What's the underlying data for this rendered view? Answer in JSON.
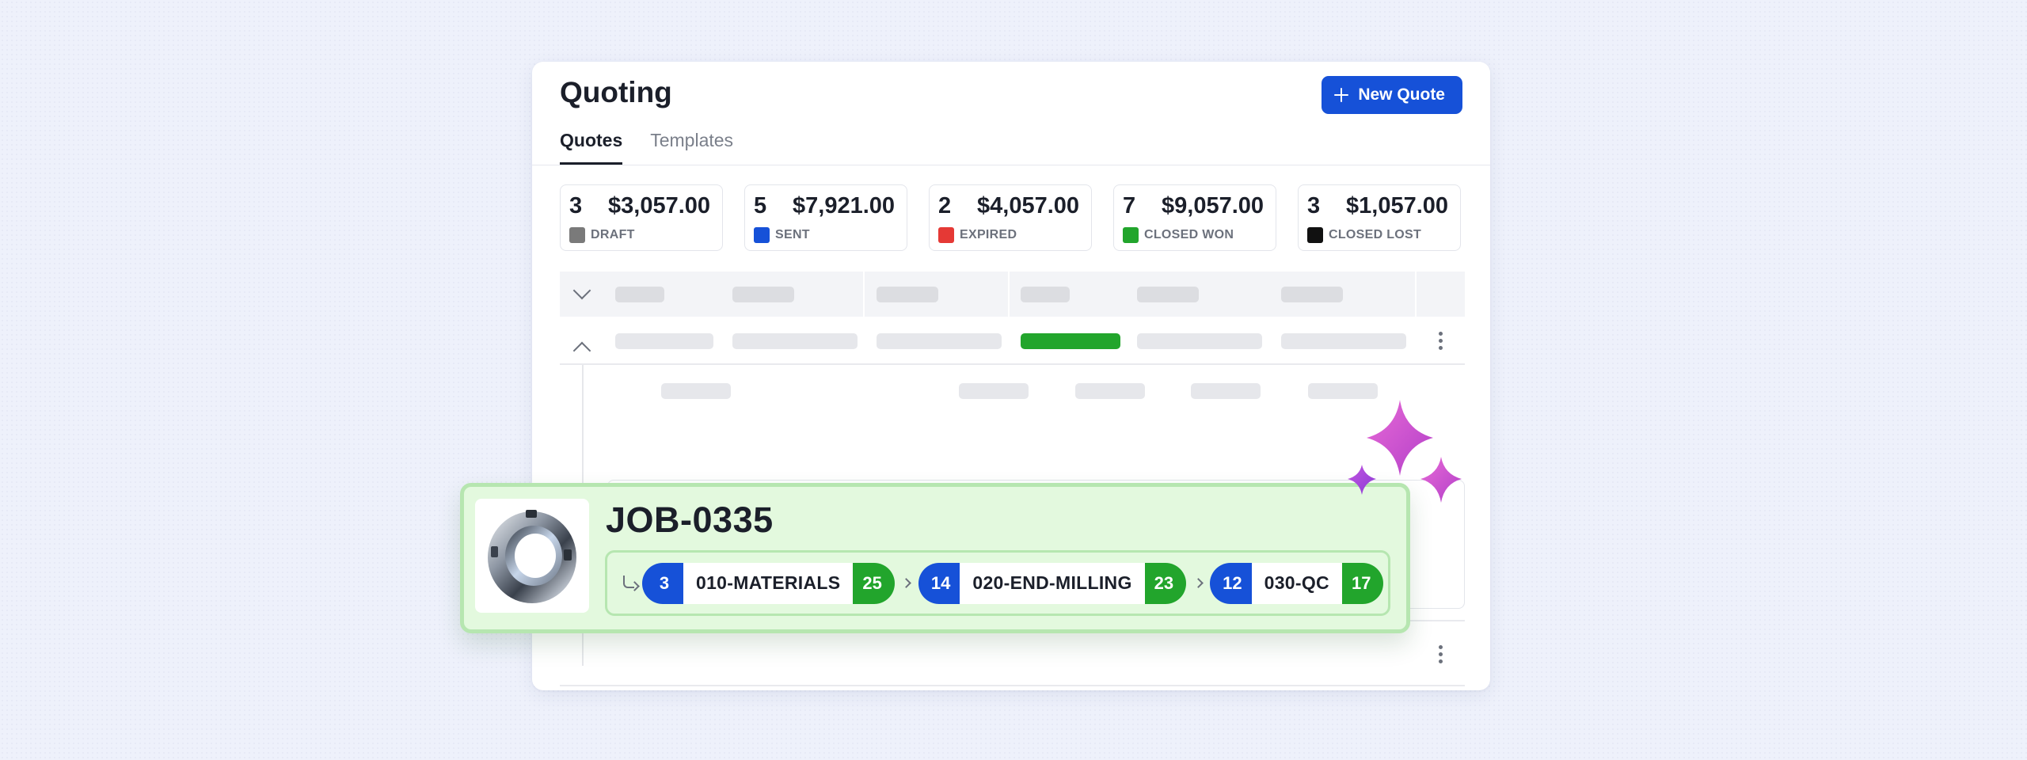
{
  "header": {
    "title": "Quoting",
    "new_quote_label": "New Quote",
    "accent": "#1651d8"
  },
  "tabs": [
    {
      "label": "Quotes",
      "active": true
    },
    {
      "label": "Templates",
      "active": false
    }
  ],
  "stats": [
    {
      "count": "3",
      "amount": "$3,057.00",
      "label": "DRAFT",
      "color": "#7a7a7a"
    },
    {
      "count": "5",
      "amount": "$7,921.00",
      "label": "SENT",
      "color": "#1651d8"
    },
    {
      "count": "2",
      "amount": "$4,057.00",
      "label": "EXPIRED",
      "color": "#e53935"
    },
    {
      "count": "7",
      "amount": "$9,057.00",
      "label": "CLOSED WON",
      "color": "#22a52c"
    },
    {
      "count": "3",
      "amount": "$1,057.00",
      "label": "CLOSED LOST",
      "color": "#111111"
    }
  ],
  "job": {
    "title": "JOB-0335",
    "operations": [
      {
        "left": "3",
        "name": "010-MATERIALS",
        "right": "25"
      },
      {
        "left": "14",
        "name": "020-END-MILLING",
        "right": "23"
      },
      {
        "left": "12",
        "name": "030-QC",
        "right": "17"
      }
    ],
    "colors": {
      "left_badge": "#1651d8",
      "right_badge": "#22a52c",
      "card_bg": "#e3f9de"
    }
  },
  "icons": {
    "expand": "chevron-down-icon",
    "collapse": "chevron-up-icon",
    "menu": "kebab-menu-icon",
    "add": "plus-icon",
    "sparkle": "sparkle-icon",
    "return": "return-arrow-icon",
    "separator": "chevron-right-icon"
  }
}
